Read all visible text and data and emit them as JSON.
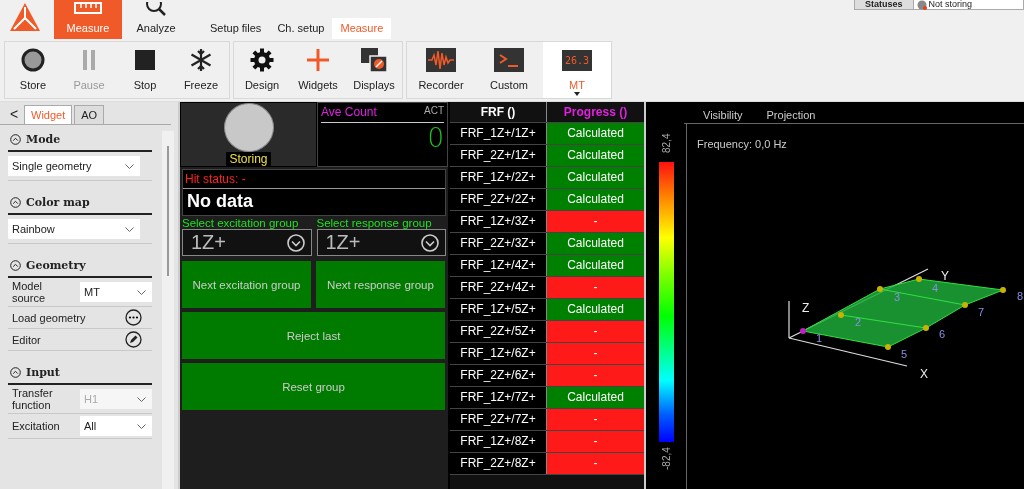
{
  "status_strip": {
    "button": "Statuses",
    "storing": "Not storing"
  },
  "main_tabs": [
    {
      "label": "Measure",
      "selected": true
    },
    {
      "label": "Analyze",
      "selected": false
    }
  ],
  "sub_tabs": [
    {
      "label": "Setup files",
      "selected": false
    },
    {
      "label": "Ch. setup",
      "selected": false
    },
    {
      "label": "Measure",
      "selected": true
    }
  ],
  "toolbar_groups": [
    [
      {
        "label": "Store",
        "disabled": false,
        "selected": false
      },
      {
        "label": "Pause",
        "disabled": true,
        "selected": false
      },
      {
        "label": "Stop",
        "disabled": false,
        "selected": false
      },
      {
        "label": "Freeze",
        "disabled": false,
        "selected": false
      }
    ],
    [
      {
        "label": "Design",
        "disabled": false,
        "selected": false
      },
      {
        "label": "Widgets",
        "disabled": false,
        "selected": false
      },
      {
        "label": "Displays",
        "disabled": false,
        "selected": false
      }
    ],
    [
      {
        "label": "Recorder",
        "disabled": false,
        "selected": false
      },
      {
        "label": "Custom",
        "disabled": false,
        "selected": false
      },
      {
        "label": "MT",
        "icon_text": "26.3",
        "disabled": false,
        "selected": true
      }
    ]
  ],
  "side_panel": {
    "back": "<",
    "tabs": [
      {
        "label": "Widget",
        "selected": true
      },
      {
        "label": "AO",
        "selected": false
      }
    ],
    "sections": [
      {
        "title": "Mode",
        "rows": [
          {
            "kind": "dropdown",
            "value": "Single geometry",
            "disabled": false
          }
        ]
      },
      {
        "title": "Color map",
        "rows": [
          {
            "kind": "dropdown",
            "value": "Rainbow",
            "disabled": false
          }
        ]
      },
      {
        "title": "Geometry",
        "rows": [
          {
            "kind": "labeled",
            "label": "Model source",
            "value": "MT",
            "disabled": false
          },
          {
            "kind": "browse",
            "label": "Load geometry"
          },
          {
            "kind": "edit",
            "label": "Editor"
          }
        ]
      },
      {
        "title": "Input",
        "rows": [
          {
            "kind": "labeled",
            "label": "Transfer function",
            "value": "H1",
            "disabled": true
          },
          {
            "kind": "labeled",
            "label": "Excitation",
            "value": "All",
            "disabled": false
          }
        ]
      }
    ]
  },
  "control": {
    "storing_label": "Storing",
    "ave_count": {
      "title": "Ave Count",
      "tag": "ACT",
      "value": "0"
    },
    "hit_status": "Hit status: -",
    "message": "No data",
    "excitation": {
      "label": "Select excitation group",
      "value": "1Z+"
    },
    "response": {
      "label": "Select response group",
      "value": "1Z+"
    },
    "buttons": [
      "Next excitation group",
      "Next response group",
      "Reject last",
      "Reset group"
    ]
  },
  "frf_table": {
    "columns": [
      "FRF ()",
      "Progress ()"
    ],
    "rows": [
      {
        "frf": "FRF_1Z+/1Z+",
        "progress": "Calculated",
        "kind": "done"
      },
      {
        "frf": "FRF_2Z+/1Z+",
        "progress": "Calculated",
        "kind": "done"
      },
      {
        "frf": "FRF_1Z+/2Z+",
        "progress": "Calculated",
        "kind": "done"
      },
      {
        "frf": "FRF_2Z+/2Z+",
        "progress": "Calculated",
        "kind": "done"
      },
      {
        "frf": "FRF_1Z+/3Z+",
        "progress": "-",
        "kind": "missing"
      },
      {
        "frf": "FRF_2Z+/3Z+",
        "progress": "Calculated",
        "kind": "done"
      },
      {
        "frf": "FRF_1Z+/4Z+",
        "progress": "Calculated",
        "kind": "done"
      },
      {
        "frf": "FRF_2Z+/4Z+",
        "progress": "-",
        "kind": "missing"
      },
      {
        "frf": "FRF_1Z+/5Z+",
        "progress": "Calculated",
        "kind": "done"
      },
      {
        "frf": "FRF_2Z+/5Z+",
        "progress": "-",
        "kind": "missing"
      },
      {
        "frf": "FRF_1Z+/6Z+",
        "progress": "-",
        "kind": "missing"
      },
      {
        "frf": "FRF_2Z+/6Z+",
        "progress": "-",
        "kind": "missing"
      },
      {
        "frf": "FRF_1Z+/7Z+",
        "progress": "Calculated",
        "kind": "done"
      },
      {
        "frf": "FRF_2Z+/7Z+",
        "progress": "-",
        "kind": "missing"
      },
      {
        "frf": "FRF_1Z+/8Z+",
        "progress": "-",
        "kind": "missing"
      },
      {
        "frf": "FRF_2Z+/8Z+",
        "progress": "-",
        "kind": "missing"
      }
    ]
  },
  "geometry_view": {
    "menu": [
      "Visibility",
      "Projection"
    ],
    "frequency": "Frequency: 0,0 Hz",
    "scale_max": "82,4",
    "scale_min": "-82,4",
    "axes": [
      "X",
      "Y",
      "Z"
    ],
    "nodes": [
      "1",
      "2",
      "3",
      "4",
      "5",
      "6",
      "7",
      "8"
    ]
  }
}
